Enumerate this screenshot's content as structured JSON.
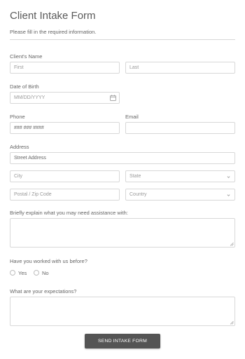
{
  "form": {
    "title": "Client Intake Form",
    "subtitle": "Please fill in the required information.",
    "client_name": {
      "label": "Client's Name",
      "first_placeholder": "First",
      "last_placeholder": "Last"
    },
    "dob": {
      "label": "Date of Birth",
      "placeholder": "MM/DD/YYYY",
      "icon": "calendar-icon"
    },
    "phone": {
      "label": "Phone",
      "placeholder": "### ### ####"
    },
    "email": {
      "label": "Email",
      "placeholder": ""
    },
    "address": {
      "label": "Address",
      "street_placeholder": "Street Address",
      "city_placeholder": "City",
      "state_placeholder": "State",
      "zip_placeholder": "Postal / Zip Code",
      "country_placeholder": "Country"
    },
    "assistance": {
      "label": "Briefly explain what you may need assistance with:"
    },
    "worked_before": {
      "label": "Have you worked with us before?",
      "options": [
        "Yes",
        "No"
      ]
    },
    "expectations": {
      "label": "What are your expectations?"
    },
    "submit_label": "SEND INTAKE FORM"
  },
  "colors": {
    "button_bg": "#545454",
    "border": "#d8d8d8",
    "text": "#666666"
  }
}
